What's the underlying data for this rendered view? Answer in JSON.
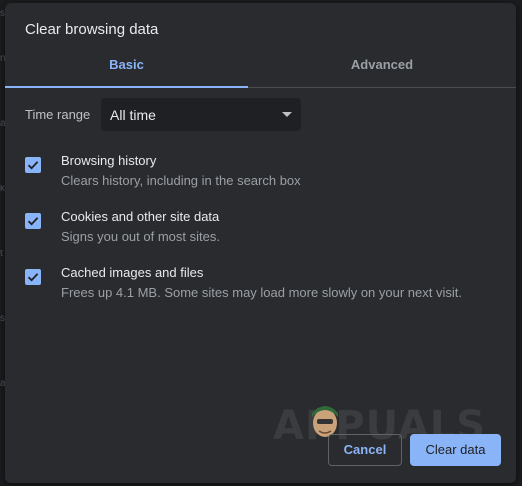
{
  "dialog": {
    "title": "Clear browsing data"
  },
  "tabs": [
    {
      "label": "Basic",
      "selected": true
    },
    {
      "label": "Advanced",
      "selected": false
    }
  ],
  "time_range": {
    "label": "Time range",
    "value": "All time"
  },
  "options": [
    {
      "title": "Browsing history",
      "description": "Clears history, including in the search box",
      "checked": true
    },
    {
      "title": "Cookies and other site data",
      "description": "Signs you out of most sites.",
      "checked": true
    },
    {
      "title": "Cached images and files",
      "description": "Frees up 4.1 MB. Some sites may load more slowly on your next visit.",
      "checked": true
    }
  ],
  "buttons": {
    "cancel": "Cancel",
    "clear": "Clear data"
  },
  "watermark": {
    "text": "APPUALS"
  },
  "colors": {
    "accent": "#8ab4f8",
    "dialog_bg": "#2a2b2e",
    "text_primary": "#e8eaed",
    "text_secondary": "#9aa0a6"
  },
  "icons": {
    "checkbox": "check-icon",
    "dropdown": "dropdown-arrow-icon"
  }
}
